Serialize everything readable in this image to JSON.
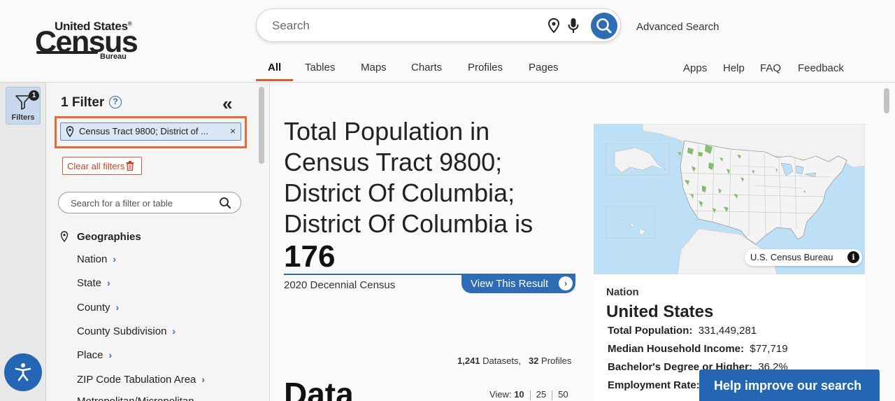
{
  "header": {
    "logo": {
      "line1": "United States",
      "reg": "®",
      "line2": "Census",
      "line3": "Bureau"
    },
    "search": {
      "placeholder": "Search"
    },
    "advanced_search": "Advanced Search",
    "tabs": [
      {
        "label": "All",
        "active": true
      },
      {
        "label": "Tables"
      },
      {
        "label": "Maps"
      },
      {
        "label": "Charts"
      },
      {
        "label": "Profiles"
      },
      {
        "label": "Pages"
      }
    ],
    "util_links": [
      "Apps",
      "Help",
      "FAQ",
      "Feedback"
    ]
  },
  "rail": {
    "filters_label": "Filters",
    "filters_count": "1"
  },
  "filter_panel": {
    "title": "1 Filter",
    "help": "?",
    "collapse": "«",
    "active_chip": "Census Tract 9800; District of ...",
    "chip_close": "×",
    "clear_all": "Clear all filters",
    "search_placeholder": "Search for a filter or table",
    "section_title": "Geographies",
    "geo_items": [
      "Nation",
      "State",
      "County",
      "County Subdivision",
      "Place",
      "ZIP Code Tabulation Area",
      "Metropolitan/Micropolitan"
    ]
  },
  "result": {
    "headline": "Total Population in Census Tract 9800; District Of Columbia; District Of Columbia is",
    "value": "176",
    "source": "2020 Decennial Census",
    "view_button": "View This Result",
    "view_arrow": "›"
  },
  "counts": {
    "datasets_num": "1,241",
    "datasets_lbl": "Datasets,",
    "profiles_num": "32",
    "profiles_lbl": "Profiles"
  },
  "data_section": {
    "title": "Data",
    "view_label": "View:",
    "view_options": [
      "10",
      "25",
      "50"
    ]
  },
  "map_card": {
    "credit": "U.S. Census Bureau",
    "info": "i",
    "level": "Nation",
    "name": "United States",
    "stats": [
      {
        "label": "Total Population:",
        "value": "331,449,281"
      },
      {
        "label": "Median Household Income:",
        "value": "$77,719"
      },
      {
        "label": "Bachelor's Degree or Higher:",
        "value": "36.2%"
      },
      {
        "label": "Employment Rate:",
        "value": ""
      }
    ]
  },
  "help_improve": "Help improve our search",
  "colors": {
    "accent": "#2e6db5",
    "highlight": "#e8693a",
    "underline": "#e05a2a"
  }
}
